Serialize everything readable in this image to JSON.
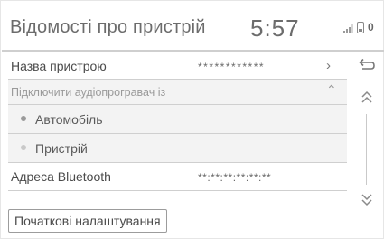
{
  "header": {
    "title": "Відомості про пристрій",
    "clock": "5:57",
    "status_count": "0"
  },
  "rows": {
    "device_name": {
      "label": "Назва пристрою",
      "value": "************",
      "chevron": "›"
    },
    "connect_player": {
      "label": "Підключити аудіопрогравач із",
      "chevron": "⌃"
    },
    "option_car": {
      "label": "Автомобіль"
    },
    "option_device": {
      "label": "Пристрій"
    },
    "bluetooth": {
      "label": "Адреса Bluetooth",
      "value": "**:**:**:**:**:**"
    }
  },
  "footer": {
    "reset_label": "Початкові налаштування"
  },
  "icons": {
    "back": "back-arrow-icon",
    "scroll_up": "double-chevron-up-icon",
    "scroll_down": "double-chevron-down-icon",
    "signal": "signal-strength-icon",
    "phone": "phone-battery-icon"
  }
}
